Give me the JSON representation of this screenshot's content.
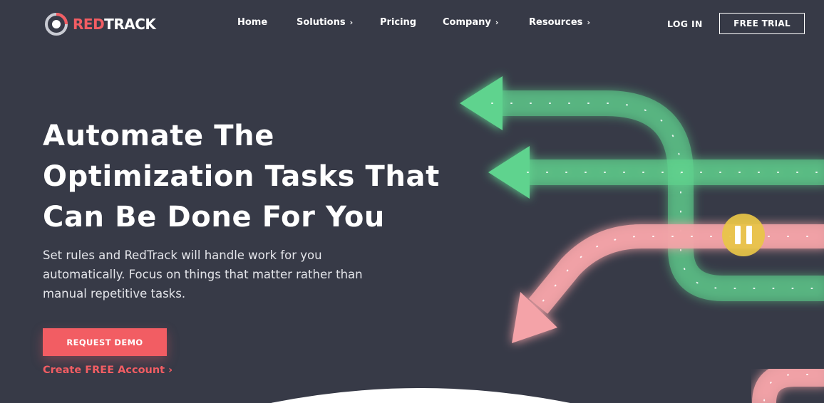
{
  "brand": {
    "name_red": "RED",
    "name_white": "TRACK",
    "accent": "#f25d63",
    "background": "#373a47"
  },
  "nav": {
    "items": [
      {
        "label": "Home",
        "has_submenu": false
      },
      {
        "label": "Solutions",
        "has_submenu": true
      },
      {
        "label": "Pricing",
        "has_submenu": false
      },
      {
        "label": "Company",
        "has_submenu": true
      },
      {
        "label": "Resources",
        "has_submenu": true
      }
    ],
    "chevron": "›",
    "login_label": "LOG IN",
    "trial_label": "FREE TRIAL"
  },
  "hero": {
    "title_line1": "Automate The",
    "title_line2": "Optimization Tasks That",
    "title_line3": "Can Be Done For You",
    "subtitle": "Set rules and RedTrack will handle work for you automatically. Focus on things that matter rather than manual repetitive tasks.",
    "demo_label": "REQUEST DEMO",
    "create_label": "Create FREE Account ›"
  },
  "illustration": {
    "green_color": "#5fd38e",
    "pink_color": "#f4a3a8",
    "pause_color": "#e8c547",
    "pause_icon": "pause-icon"
  }
}
